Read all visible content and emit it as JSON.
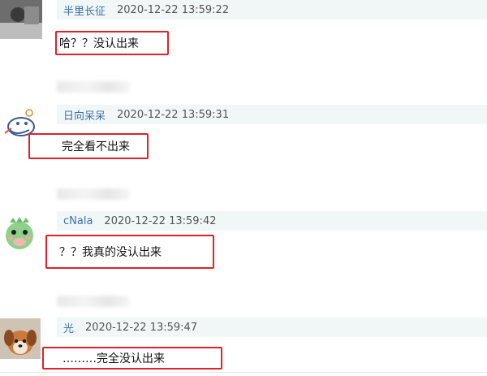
{
  "comments": [
    {
      "username": "半里长征",
      "timestamp": "2020-12-22 13:59:22",
      "message": "哈？？没认出来",
      "avatar_icon": "person-photo-avatar"
    },
    {
      "username": "日向呆呆",
      "timestamp": "2020-12-22 13:59:31",
      "message": "完全看不出来",
      "avatar_icon": "cartoon-drawing-avatar"
    },
    {
      "username": "cNala",
      "timestamp": "2020-12-22 13:59:42",
      "message": "？？我真的没认出来",
      "avatar_icon": "green-dinosaur-avatar"
    },
    {
      "username": "光",
      "timestamp": "2020-12-22 13:59:47",
      "message": "………完全没认出来",
      "avatar_icon": "dog-photo-avatar"
    }
  ],
  "colors": {
    "username": "#3a6fa8",
    "meta_bar_bg": "#f1f7f6",
    "highlight_border": "#e0222a",
    "message_text": "#111111"
  }
}
